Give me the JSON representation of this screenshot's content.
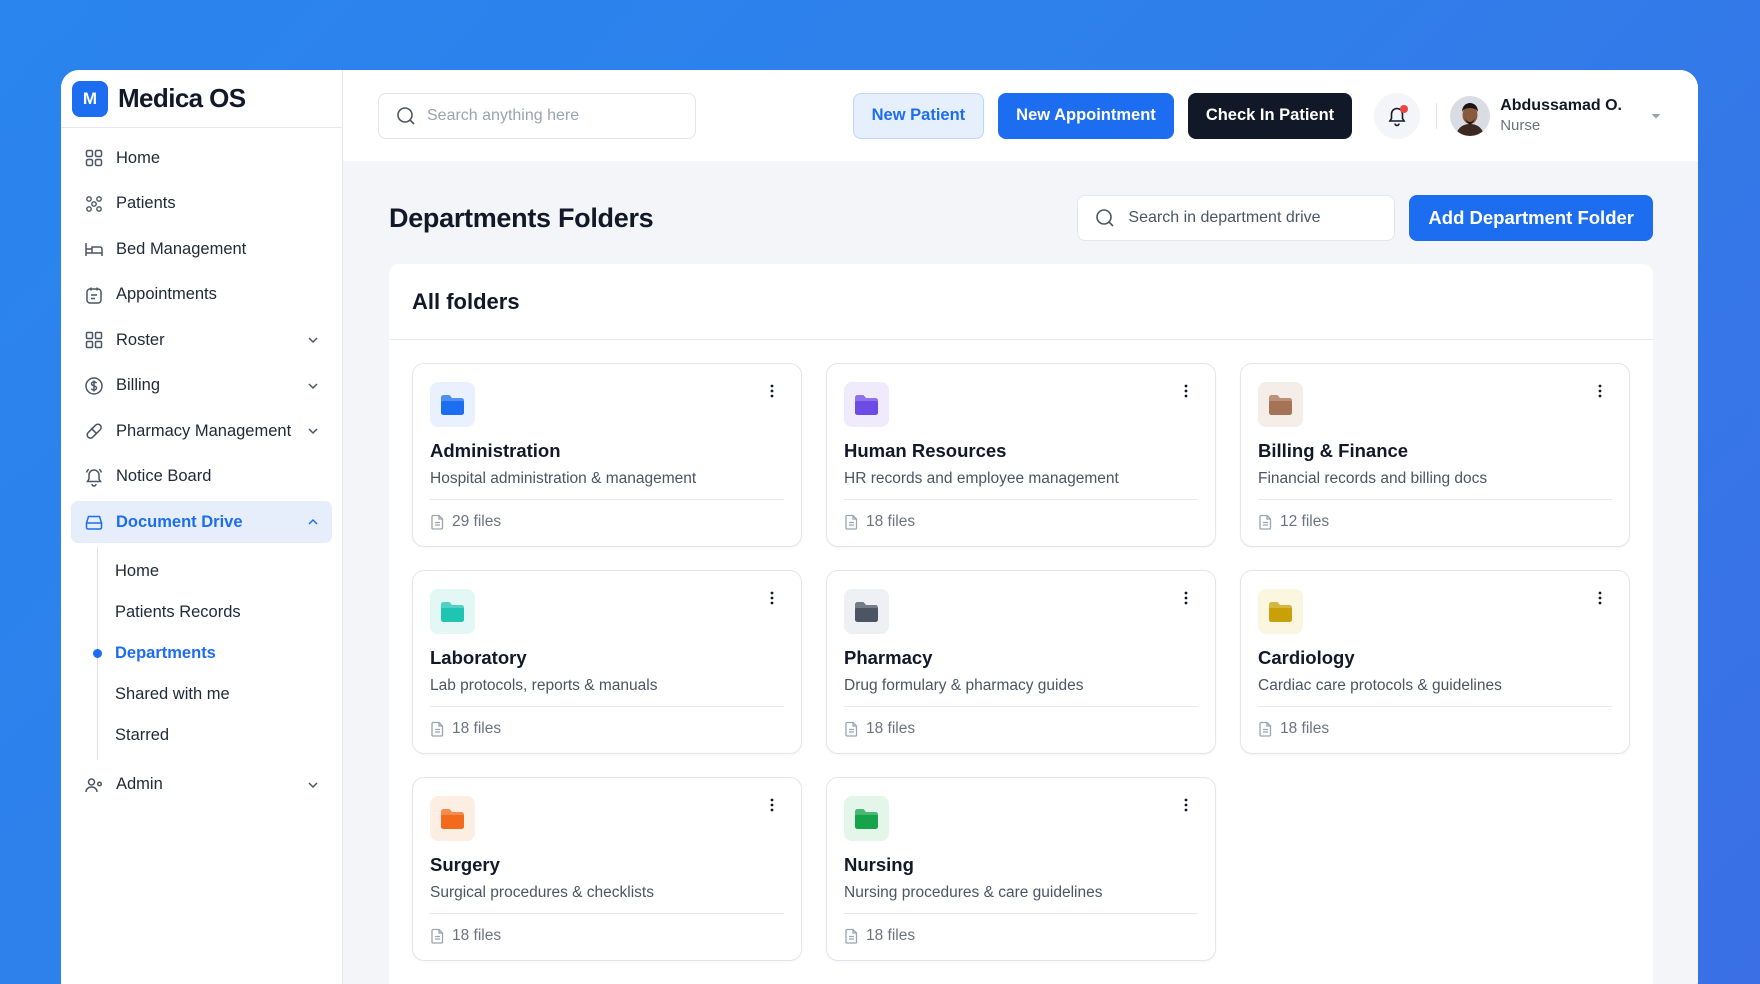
{
  "brand": {
    "logo_letter": "M",
    "name": "Medica OS",
    "accent": "#1d6df0"
  },
  "sidebar": {
    "items": [
      {
        "label": "Home",
        "icon": "grid-icon",
        "expandable": false
      },
      {
        "label": "Patients",
        "icon": "patients-icon",
        "expandable": false
      },
      {
        "label": "Bed Management",
        "icon": "bed-icon",
        "expandable": false
      },
      {
        "label": "Appointments",
        "icon": "calendar-icon",
        "expandable": false
      },
      {
        "label": "Roster",
        "icon": "roster-grid-icon",
        "expandable": true
      },
      {
        "label": "Billing",
        "icon": "dollar-icon",
        "expandable": true
      },
      {
        "label": "Pharmacy Management",
        "icon": "pill-icon",
        "expandable": true
      },
      {
        "label": "Notice Board",
        "icon": "bell-icon",
        "expandable": false
      },
      {
        "label": "Document Drive",
        "icon": "drive-icon",
        "expandable": true,
        "active": true
      },
      {
        "label": "Admin",
        "icon": "admin-icon",
        "expandable": true
      }
    ],
    "document_drive_sub": [
      {
        "label": "Home",
        "active": false
      },
      {
        "label": "Patients Records",
        "active": false
      },
      {
        "label": "Departments",
        "active": true
      },
      {
        "label": "Shared with me",
        "active": false
      },
      {
        "label": "Starred",
        "active": false
      }
    ]
  },
  "topbar": {
    "search_placeholder": "Search anything here",
    "new_patient": "New Patient",
    "new_appointment": "New Appointment",
    "check_in_patient": "Check In Patient",
    "user": {
      "name": "Abdussamad O.",
      "role": "Nurse"
    },
    "notification_dot_color": "#ef4444"
  },
  "content": {
    "title": "Departments Folders",
    "search_placeholder": "Search in department drive",
    "add_button": "Add Department Folder",
    "panel_title": "All folders",
    "folders": [
      {
        "name": "Administration",
        "description": "Hospital administration & management",
        "files": "29 files",
        "color": "#1d6df0",
        "bg": "#e8f1fd"
      },
      {
        "name": "Human Resources",
        "description": "HR records and employee management",
        "files": "18 files",
        "color": "#6d4ce6",
        "bg": "#efebfc"
      },
      {
        "name": "Billing & Finance",
        "description": "Financial records and billing docs",
        "files": "12 files",
        "color": "#a57355",
        "bg": "#f5ede7"
      },
      {
        "name": "Laboratory",
        "description": "Lab protocols, reports & manuals",
        "files": "18 files",
        "color": "#1fc4b2",
        "bg": "#e3f8f5"
      },
      {
        "name": "Pharmacy",
        "description": "Drug formulary & pharmacy guides",
        "files": "18 files",
        "color": "#4b5563",
        "bg": "#eef0f3"
      },
      {
        "name": "Cardiology",
        "description": "Cardiac care protocols & guidelines",
        "files": "18 files",
        "color": "#caa00a",
        "bg": "#fbf6df"
      },
      {
        "name": "Surgery",
        "description": "Surgical procedures & checklists",
        "files": "18 files",
        "color": "#f26a1b",
        "bg": "#fdeee4"
      },
      {
        "name": "Nursing",
        "description": "Nursing procedures & care guidelines",
        "files": "18 files",
        "color": "#16a34a",
        "bg": "#e4f6ea"
      }
    ]
  }
}
